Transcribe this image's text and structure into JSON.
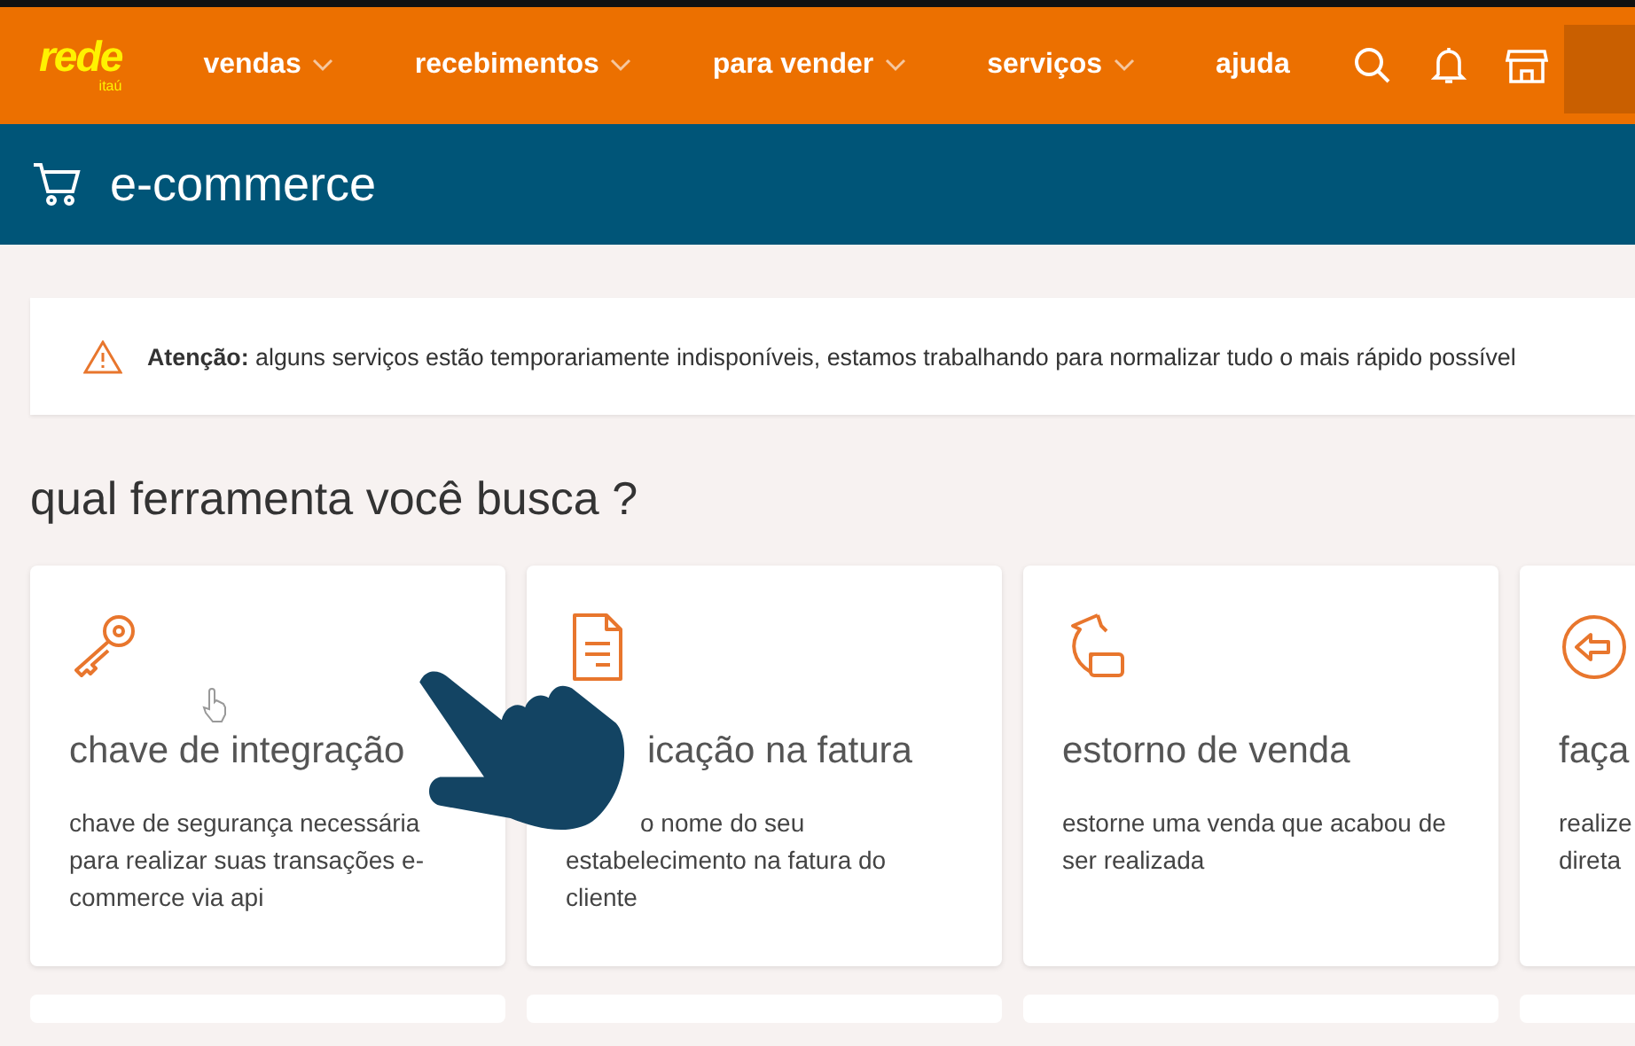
{
  "nav": {
    "logo": "rede",
    "logo_sub": "itaú",
    "items": [
      {
        "label": "vendas",
        "dropdown": true
      },
      {
        "label": "recebimentos",
        "dropdown": true
      },
      {
        "label": "para vender",
        "dropdown": true
      },
      {
        "label": "serviços",
        "dropdown": true
      },
      {
        "label": "ajuda",
        "dropdown": false
      }
    ]
  },
  "header": {
    "title": "e-commerce"
  },
  "alert": {
    "label": "Atenção:",
    "text": "alguns serviços estão temporariamente indisponíveis, estamos trabalhando para normalizar tudo o mais rápido possível"
  },
  "heading": "qual ferramenta você busca ?",
  "cards": [
    {
      "kind": "key",
      "title": "chave de integração",
      "description": "chave de segurança necessária para realizar suas transações e-commerce via api"
    },
    {
      "kind": "document",
      "title": "icação na fatura",
      "description": "o nome do seu estabelecimento na fatura do cliente"
    },
    {
      "kind": "refund",
      "title": "estorno de venda",
      "description": "estorne uma venda que acabou de ser realizada"
    },
    {
      "kind": "back",
      "title": "faça",
      "description": "realize\ndireta"
    }
  ]
}
